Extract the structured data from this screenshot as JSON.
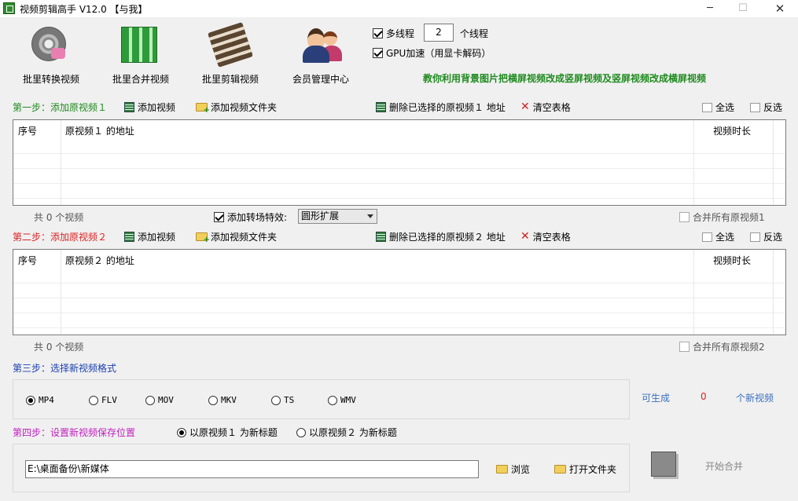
{
  "window": {
    "title": "视频剪辑高手 V12.0 【与我】",
    "min": "─",
    "max": "☐",
    "close": "✕"
  },
  "big_buttons": [
    {
      "label": "批里转换视频",
      "icon": "film-reel-icon"
    },
    {
      "label": "批里合并视频",
      "icon": "green-building-icon"
    },
    {
      "label": "批里剪辑视频",
      "icon": "film-strip-icon"
    },
    {
      "label": "会员管理中心",
      "icon": "users-icon"
    }
  ],
  "options": {
    "multithread_label": "多线程",
    "multithread_checked": true,
    "thread_count": "2",
    "thread_suffix": "个线程",
    "gpu_label": "GPU加速（用显卡解码）",
    "gpu_checked": true,
    "tip": "教你利用背景图片把横屏视频改成竖屏视频及竖屏视频改成横屏视频"
  },
  "step1": {
    "label": "第一步：添加原视频１",
    "add_video": "添加视频",
    "add_folder": "添加视频文件夹",
    "delete_selected": "删除已选择的原视频１ 地址",
    "clear": "清空表格",
    "select_all": "全选",
    "invert": "反选",
    "col_index": "序号",
    "col_path": "原视频１ 的地址",
    "col_duration": "视频时长",
    "count": "共 0 个视频",
    "merge_all": "合并所有原视频1"
  },
  "transition": {
    "label": "添加转场特效:",
    "checked": true,
    "value": "圆形扩展"
  },
  "step2": {
    "label": "第二步：添加原视频２",
    "add_video": "添加视频",
    "add_folder": "添加视频文件夹",
    "delete_selected": "删除已选择的原视频２ 地址",
    "clear": "清空表格",
    "select_all": "全选",
    "invert": "反选",
    "col_index": "序号",
    "col_path": "原视频２ 的地址",
    "col_duration": "视频时长",
    "count": "共 0 个视频",
    "merge_all": "合并所有原视频2"
  },
  "step3": {
    "label": "第三步：选择新视频格式",
    "formats": [
      "MP4",
      "FLV",
      "MOV",
      "MKV",
      "TS",
      "WMV"
    ],
    "selected": "MP4",
    "can_generate": "可生成",
    "gen_count": "0",
    "gen_suffix": "个新视频"
  },
  "step4": {
    "label": "第四步：设置新视频保存位置",
    "title_opt1": "以原视频１ 为新标题",
    "title_opt2": "以原视频２ 为新标题",
    "selected_opt": 1,
    "save_path": "E:\\桌面备份\\新媒体",
    "browse": "浏览",
    "open_folder": "打开文件夹",
    "start": "开始合并"
  },
  "colors": {
    "green": "#1e8a1e",
    "red": "#dd2222",
    "blue": "#1a3fb0",
    "magenta": "#c020c0"
  }
}
